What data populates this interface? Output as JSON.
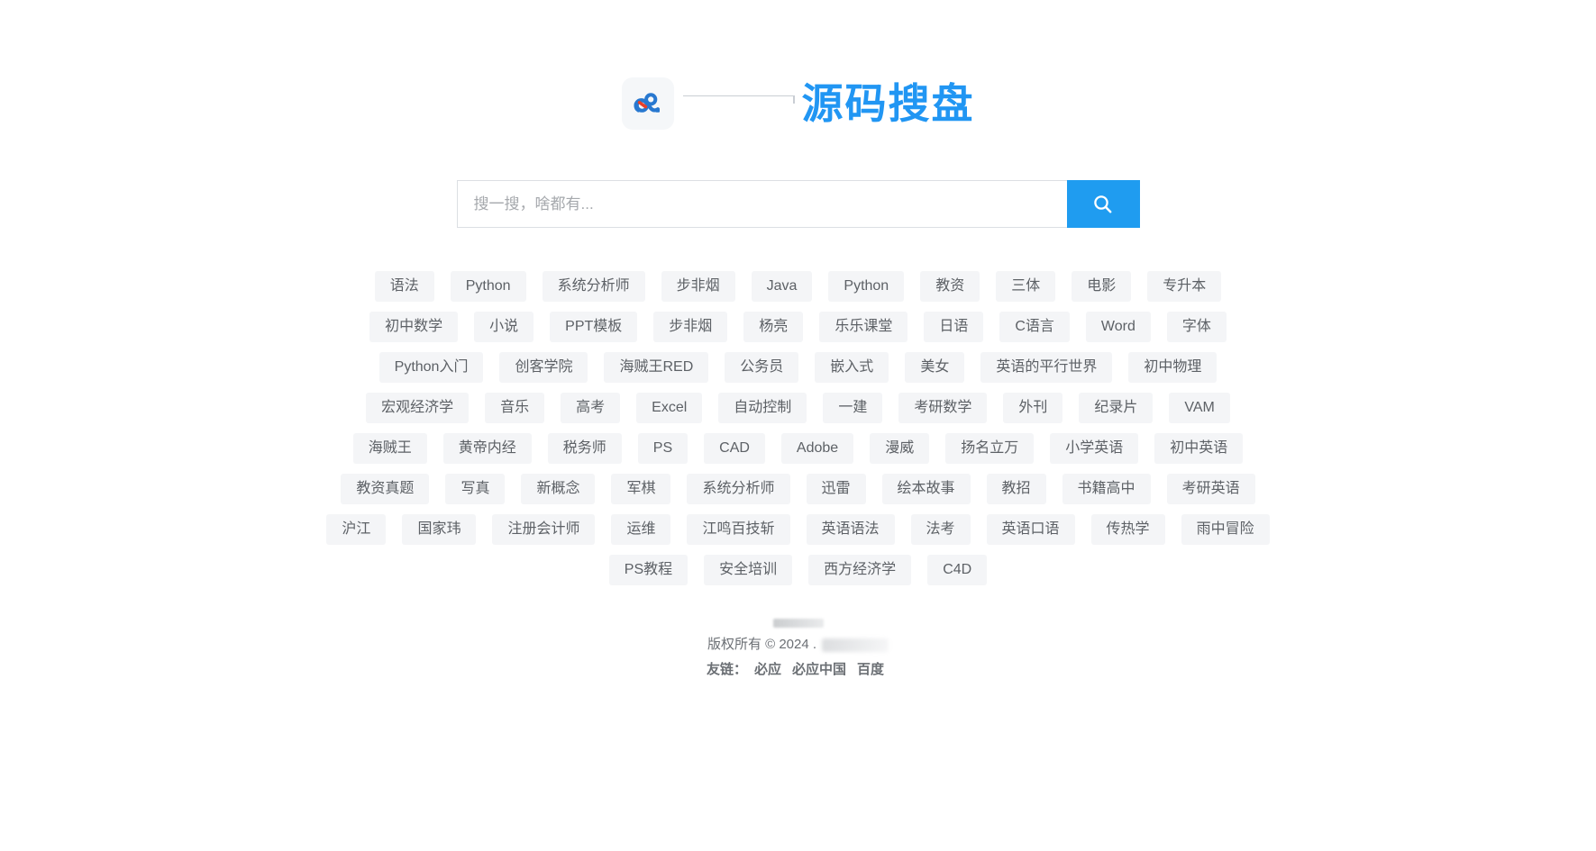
{
  "brand": {
    "logo_icon": "baidu-cloud-logo-icon",
    "title": "源码搜盘",
    "title_color": "#2196f3"
  },
  "search": {
    "placeholder": "搜一搜，啥都有...",
    "value": "",
    "button_icon": "search-icon",
    "button_color": "#1f9cf0"
  },
  "tag_cloud": {
    "rows": [
      [
        "语法",
        "Python",
        "系统分析师",
        "步非烟",
        "Java",
        "Python",
        "教资",
        "三体",
        "电影",
        "专升本"
      ],
      [
        "初中数学",
        "小说",
        "PPT模板",
        "步非烟",
        "杨亮",
        "乐乐课堂",
        "日语",
        "C语言",
        "Word",
        "字体"
      ],
      [
        "Python入门",
        "创客学院",
        "海贼王RED",
        "公务员",
        "嵌入式",
        "美女",
        "英语的平行世界",
        "初中物理"
      ],
      [
        "宏观经济学",
        "音乐",
        "高考",
        "Excel",
        "自动控制",
        "一建",
        "考研数学",
        "外刊",
        "纪录片",
        "VAM"
      ],
      [
        "海贼王",
        "黄帝内经",
        "税务师",
        "PS",
        "CAD",
        "Adobe",
        "漫威",
        "扬名立万",
        "小学英语",
        "初中英语"
      ],
      [
        "教资真题",
        "写真",
        "新概念",
        "军棋",
        "系统分析师",
        "迅雷",
        "绘本故事",
        "教招",
        "书籍高中",
        "考研英语"
      ],
      [
        "沪江",
        "国家玮",
        "注册会计师",
        "运维",
        "江鸣百技斩",
        "英语语法",
        "法考",
        "英语口语",
        "传热学",
        "雨中冒险"
      ],
      [
        "PS教程",
        "安全培训",
        "西方经济学",
        "C4D"
      ]
    ]
  },
  "footer": {
    "copyright": "版权所有 © 2024 .",
    "links_label": "友链：",
    "links": [
      "必应",
      "必应中国",
      "百度"
    ]
  }
}
